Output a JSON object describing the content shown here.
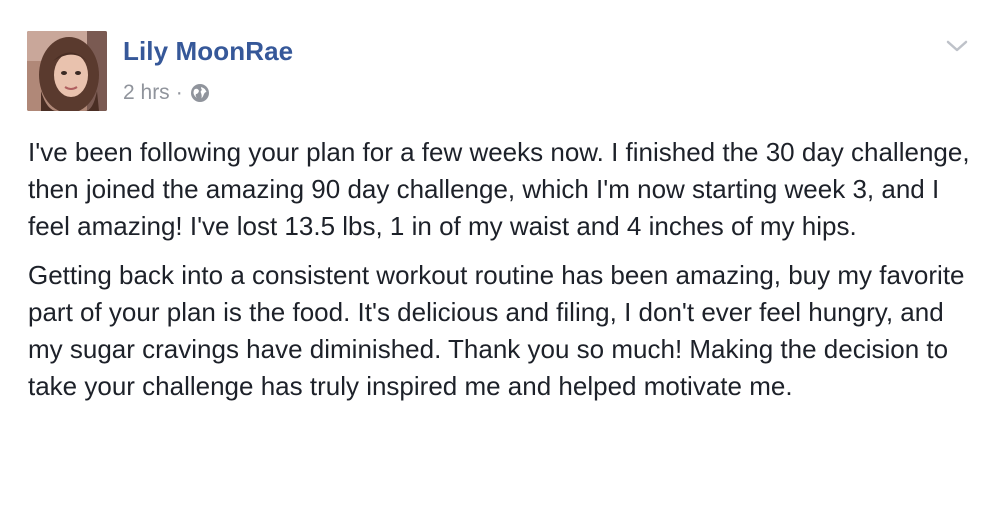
{
  "post": {
    "author": "Lily MoonRae",
    "timestamp": "2 hrs",
    "separator": "·",
    "privacy_icon": "globe-icon",
    "menu_icon": "chevron-down-icon",
    "paragraphs": [
      "I've been following your plan for a few weeks now. I finished the 30 day challenge, then joined the amazing 90 day challenge, which I'm now starting week 3, and I feel amazing! I've lost 13.5 lbs, 1 in of my waist and 4 inches of my hips.",
      "Getting back into a consistent workout routine has been amazing, buy my favorite part of your plan is the food. It's delicious and filing, I don't ever feel hungry, and my sugar cravings have diminished. Thank you so much! Making the decision to take your challenge has truly inspired me and helped motivate me."
    ]
  },
  "colors": {
    "author_link": "#365899",
    "meta_text": "#90949c",
    "body_text": "#1d2129"
  }
}
